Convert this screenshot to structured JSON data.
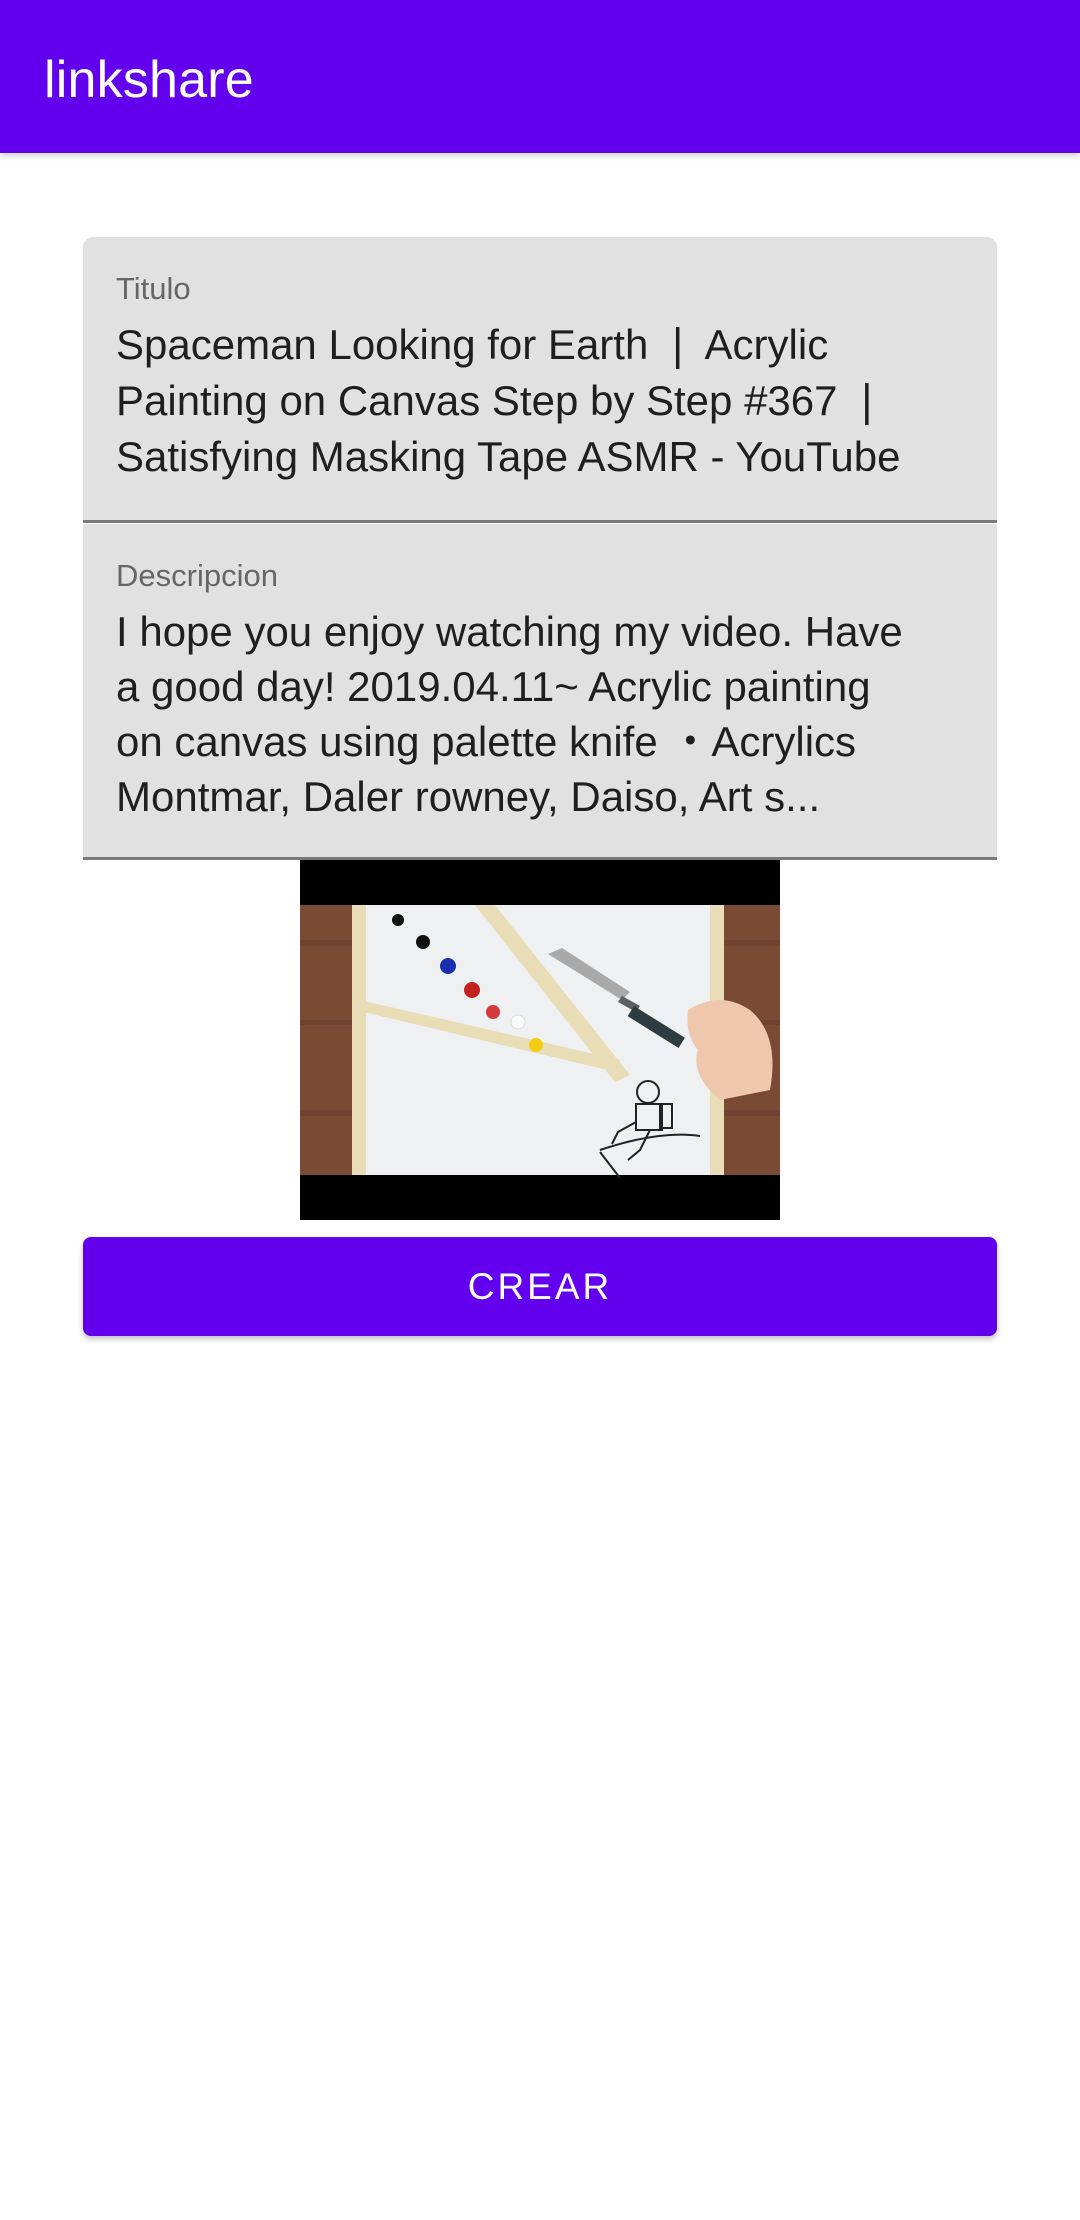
{
  "app_bar": {
    "title": "linkshare",
    "background_color": "#6200ee"
  },
  "form": {
    "titulo": {
      "label": "Titulo",
      "value": "Spaceman Looking for Earth ❘ Acrylic\nPainting on Canvas Step by Step #367 ❘\nSatisfying Masking Tape ASMR - YouTube"
    },
    "descripcion": {
      "label": "Descripcion",
      "value": "I hope you enjoy watching my video. Have\na good day! 2019.04.11~ Acrylic painting\non canvas using palette knife  ・Acrylics\nMontmar, Daler rowney, Daiso, Art s..."
    },
    "thumbnail": {
      "icon": "video-thumbnail-image"
    },
    "submit": {
      "label": "CREAR",
      "color": "#6200ee"
    }
  }
}
